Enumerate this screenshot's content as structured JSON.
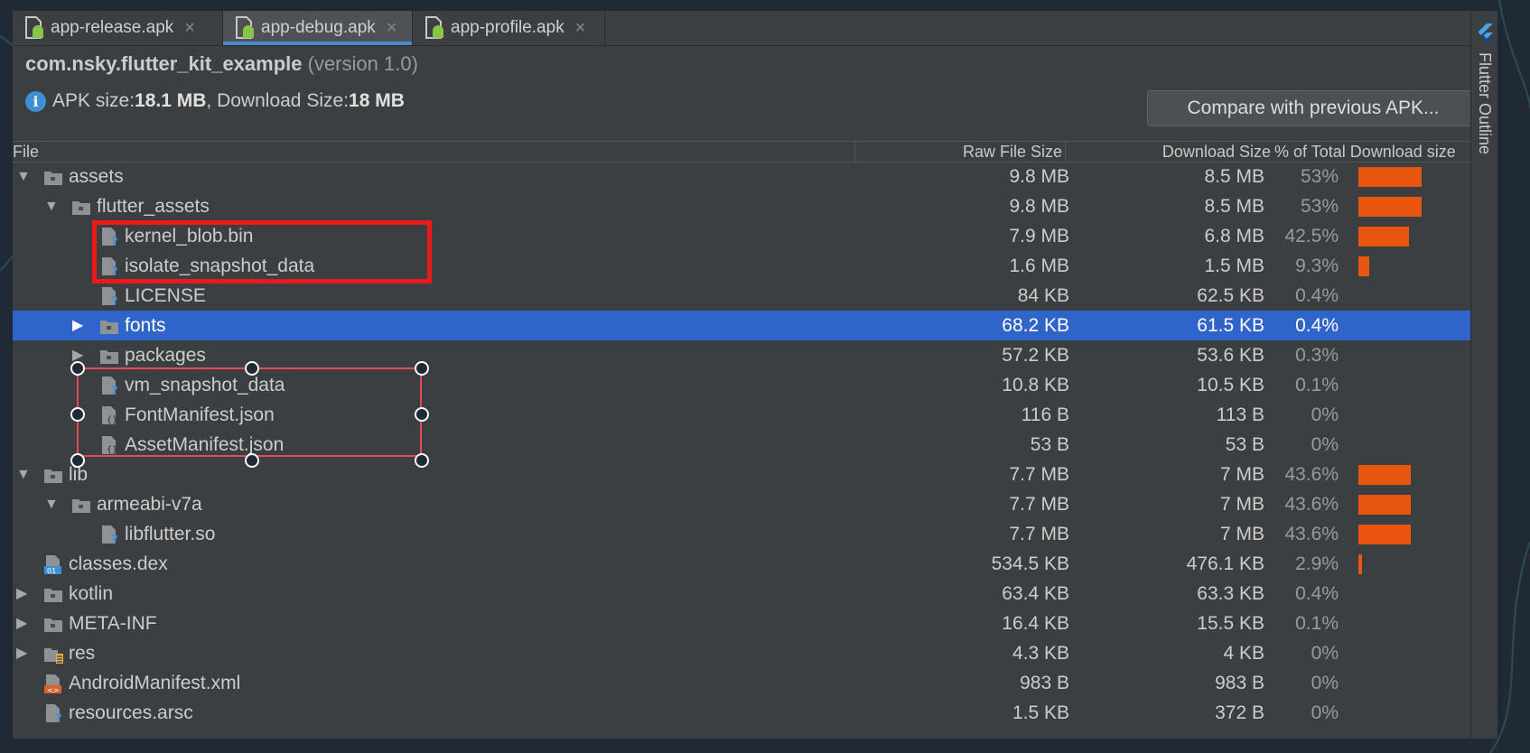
{
  "tabs": [
    {
      "label": "app-release.apk",
      "active": false
    },
    {
      "label": "app-debug.apk",
      "active": true
    },
    {
      "label": "app-profile.apk",
      "active": false
    }
  ],
  "header": {
    "package": "com.nsky.flutter_kit_example",
    "version": "(version 1.0)",
    "apk_size_label": "APK size: ",
    "apk_size_value": "18.1 MB",
    "download_size_label": ", Download Size: ",
    "download_size_value": "18 MB",
    "compare_button": "Compare with previous APK..."
  },
  "columns": {
    "file": "File",
    "raw": "Raw File Size",
    "download": "Download Size",
    "percent": "% of Total Download size"
  },
  "rows": [
    {
      "name": "assets",
      "icon": "folder-icon",
      "arrow": "expanded",
      "raw": "9.8 MB",
      "download": "8.5 MB",
      "pct": "53%",
      "pct_value": 53
    },
    {
      "name": "flutter_assets",
      "icon": "folder-icon",
      "arrow": "expanded",
      "raw": "9.8 MB",
      "download": "8.5 MB",
      "pct": "53%",
      "pct_value": 53
    },
    {
      "name": "kernel_blob.bin",
      "icon": "unknown-file-icon",
      "arrow": "none",
      "raw": "7.9 MB",
      "download": "6.8 MB",
      "pct": "42.5%",
      "pct_value": 42.5
    },
    {
      "name": "isolate_snapshot_data",
      "icon": "unknown-file-icon",
      "arrow": "none",
      "raw": "1.6 MB",
      "download": "1.5 MB",
      "pct": "9.3%",
      "pct_value": 9.3
    },
    {
      "name": "LICENSE",
      "icon": "unknown-file-icon",
      "arrow": "none",
      "raw": "84 KB",
      "download": "62.5 KB",
      "pct": "0.4%",
      "pct_value": 0.4
    },
    {
      "name": "fonts",
      "icon": "folder-icon",
      "arrow": "collapsed",
      "raw": "68.2 KB",
      "download": "61.5 KB",
      "pct": "0.4%",
      "pct_value": 0.4,
      "selected": true
    },
    {
      "name": "packages",
      "icon": "folder-icon",
      "arrow": "collapsed",
      "raw": "57.2 KB",
      "download": "53.6 KB",
      "pct": "0.3%",
      "pct_value": 0.3
    },
    {
      "name": "vm_snapshot_data",
      "icon": "unknown-file-icon",
      "arrow": "none",
      "raw": "10.8 KB",
      "download": "10.5 KB",
      "pct": "0.1%",
      "pct_value": 0.1
    },
    {
      "name": "FontManifest.json",
      "icon": "json-file-icon",
      "arrow": "none",
      "raw": "116 B",
      "download": "113 B",
      "pct": "0%",
      "pct_value": 0
    },
    {
      "name": "AssetManifest.json",
      "icon": "json-file-icon",
      "arrow": "none",
      "raw": "53 B",
      "download": "53 B",
      "pct": "0%",
      "pct_value": 0
    },
    {
      "name": "lib",
      "icon": "folder-icon",
      "arrow": "expanded",
      "raw": "7.7 MB",
      "download": "7 MB",
      "pct": "43.6%",
      "pct_value": 43.6
    },
    {
      "name": "armeabi-v7a",
      "icon": "folder-icon",
      "arrow": "expanded",
      "raw": "7.7 MB",
      "download": "7 MB",
      "pct": "43.6%",
      "pct_value": 43.6
    },
    {
      "name": "libflutter.so",
      "icon": "unknown-file-icon",
      "arrow": "none",
      "raw": "7.7 MB",
      "download": "7 MB",
      "pct": "43.6%",
      "pct_value": 43.6
    },
    {
      "name": "classes.dex",
      "icon": "dex-file-icon",
      "arrow": "none",
      "raw": "534.5 KB",
      "download": "476.1 KB",
      "pct": "2.9%",
      "pct_value": 2.9
    },
    {
      "name": "kotlin",
      "icon": "folder-icon",
      "arrow": "collapsed",
      "raw": "63.4 KB",
      "download": "63.3 KB",
      "pct": "0.4%",
      "pct_value": 0.4
    },
    {
      "name": "META-INF",
      "icon": "folder-icon",
      "arrow": "collapsed",
      "raw": "16.4 KB",
      "download": "15.5 KB",
      "pct": "0.1%",
      "pct_value": 0.1
    },
    {
      "name": "res",
      "icon": "res-folder-icon",
      "arrow": "collapsed",
      "raw": "4.3 KB",
      "download": "4 KB",
      "pct": "0%",
      "pct_value": 0
    },
    {
      "name": "AndroidManifest.xml",
      "icon": "xml-file-icon",
      "arrow": "none",
      "raw": "983 B",
      "download": "983 B",
      "pct": "0%",
      "pct_value": 0
    },
    {
      "name": "resources.arsc",
      "icon": "unknown-file-icon",
      "arrow": "none",
      "raw": "1.5 KB",
      "download": "372 B",
      "pct": "0%",
      "pct_value": 0
    }
  ],
  "side_panel": {
    "label": "Flutter Outline"
  },
  "colors": {
    "bar": "#e8560f",
    "selection": "#2f65ca",
    "annotation": "#ea1a1a"
  }
}
